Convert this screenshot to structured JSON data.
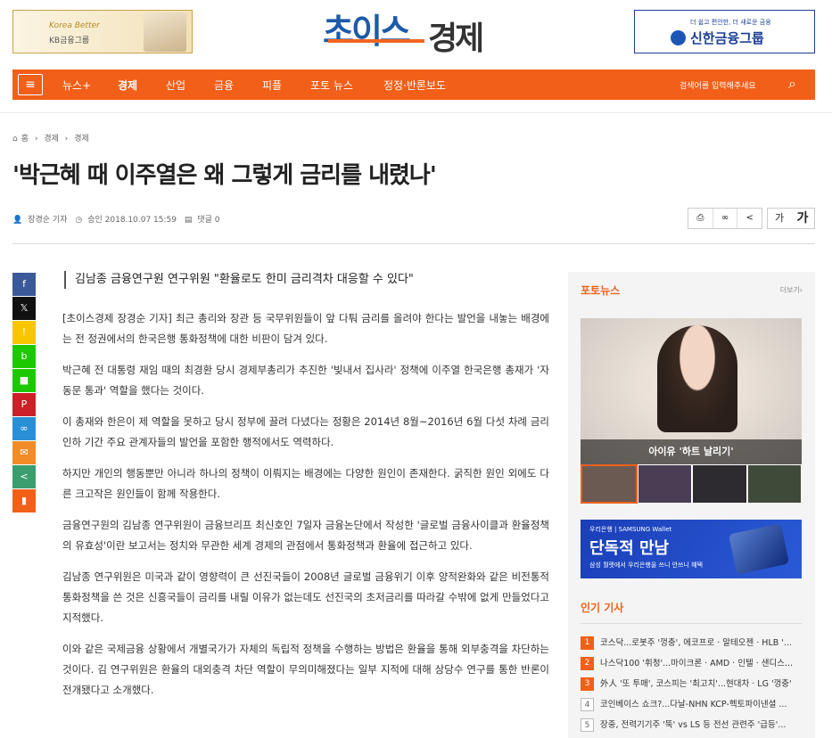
{
  "header": {
    "ad_left": {
      "line1": "Korea Better",
      "line2": "KB금융그룹"
    },
    "logo": {
      "part1": "초이스",
      "part2": "경제"
    },
    "ad_right": {
      "line1": "더 쉽고 편안한, 더 새로운 금융",
      "line2": "신한금융그룹"
    }
  },
  "nav": {
    "menu_icon": "≡",
    "items": [
      "뉴스+",
      "경제",
      "산업",
      "금융",
      "피플",
      "포토 뉴스",
      "정정·반론보도"
    ],
    "active": "경제",
    "search_placeholder": "검색어를 입력해주세요",
    "search_icon": "⌕"
  },
  "breadcrumb": {
    "home": "홈",
    "level1": "경제",
    "level2": "경제"
  },
  "article": {
    "title": "'박근혜 때 이주열은 왜 그렇게 금리를 내렸나'",
    "reporter": "장경순 기자",
    "approved": "승인 2018.10.07 15:59",
    "comments": "댓글 0",
    "font_small": "가",
    "font_large": "가",
    "subtitle": "김남종 금융연구원 연구위원 \"환율로도 한미 금리격차 대응할 수 있다\"",
    "paragraphs": [
      "[초이스경제 장경순 기자] 최근 총리와 장관 등 국무위원들이 앞 다퉈 금리를 올려야 한다는 발언을 내놓는 배경에는 전 정권에서의 한국은행 통화정책에 대한 비판이 담겨 있다.",
      "박근혜 전 대통령 재임 때의 최경환 당시 경제부총리가 추진한 '빚내서 집사라' 정책에 이주열 한국은행 총재가 '자동문 통과' 역할을 했다는 것이다.",
      "이 총재와 한은이 제 역할을 못하고 당시 정부에 끌려 다녔다는 정황은 2014년 8월~2016년 6월 다섯 차례 금리인하 기간 주요 관계자들의 발언을 포함한 행적에서도 역력하다.",
      "하지만 개인의 행동뿐만 아니라 하나의 정책이 이뤄지는 배경에는 다양한 원인이 존재한다. 굵직한 원인 외에도 다른 크고작은 원인들이 함께 작용한다.",
      "금융연구원의 김남종 연구위원이 금융브리프 최신호인 7일자 금융논단에서 작성한 '글로벌 금융사이클과 환율정책의 유효성'이란 보고서는 정치와 무관한 세계 경제의 관점에서 통화정책과 환율에 접근하고 있다.",
      "김남종 연구위원은 미국과 같이 영향력이 큰 선진국들이 2008년 글로벌 금융위기 이후 양적완화와 같은 비전통적 통화정책을 쓴 것은 신흥국들이 금리를 내릴 이유가 없는데도 선진국의 초저금리를 따라갈 수밖에 없게 만들었다고 지적했다.",
      "이와 같은 국제금융 상황에서 개별국가가 자체의 독립적 정책을 수행하는 방법은 환율을 통해 외부충격을 차단하는 것이다. 김 연구위원은 환율의 대외충격 차단 역할이 무의미해졌다는 일부 지적에 대해 상당수 연구를 통한 반론이 전개됐다고 소개했다."
    ]
  },
  "share_buttons": [
    {
      "icon": "facebook-icon",
      "glyph": "f",
      "color": "#3b5998"
    },
    {
      "icon": "x-icon",
      "glyph": "𝕏",
      "color": "#111111"
    },
    {
      "icon": "kakaostory-icon",
      "glyph": "!",
      "color": "#f7c600"
    },
    {
      "icon": "band-icon",
      "glyph": "b",
      "color": "#1ec800"
    },
    {
      "icon": "kakaotalk-icon",
      "glyph": "■",
      "color": "#1ec800"
    },
    {
      "icon": "pinterest-icon",
      "glyph": "P",
      "color": "#cb2027"
    },
    {
      "icon": "link-icon",
      "glyph": "∞",
      "color": "#2b8fd6"
    },
    {
      "icon": "email-icon",
      "glyph": "✉",
      "color": "#f28c28"
    },
    {
      "icon": "share-icon",
      "glyph": "<",
      "color": "#3a9e6e"
    },
    {
      "icon": "bookmark-icon",
      "glyph": "▮",
      "color": "#f25f18"
    }
  ],
  "sidebar": {
    "photo_news_title": "포토뉴스",
    "more": "더보기›",
    "photo_caption": "아이유 '하트 날리기'",
    "ad": {
      "line1": "우리은행 | SAMSUNG Wallet",
      "line2": "단독적 만남",
      "line3": "삼성 월렛에서 우리은행을 쓰니 안쓰니 혜택"
    },
    "popular_title": "인기 기사",
    "popular": [
      {
        "rank": "1",
        "text": "코스닥...로봇주 '껑충', 에코프로 · 알테오젠 · HLB '..."
      },
      {
        "rank": "2",
        "text": "나스닥100 '휘청'...마이크론 · AMD · 인텔 · 샌디스..."
      },
      {
        "rank": "3",
        "text": "外人 '또 투매', 코스피는 '최고치'...현대차 · LG '껑충'"
      },
      {
        "rank": "4",
        "text": "코인베이스 쇼크?...다날-NHN KCP-헥토파이낸셜 ..."
      },
      {
        "rank": "5",
        "text": "장중, 전력기기주 '뚝' vs LS 등 전선 관련주 '급등'..."
      }
    ]
  },
  "colors": {
    "accent": "#f25f18",
    "brand_blue": "#1e5aa8"
  }
}
